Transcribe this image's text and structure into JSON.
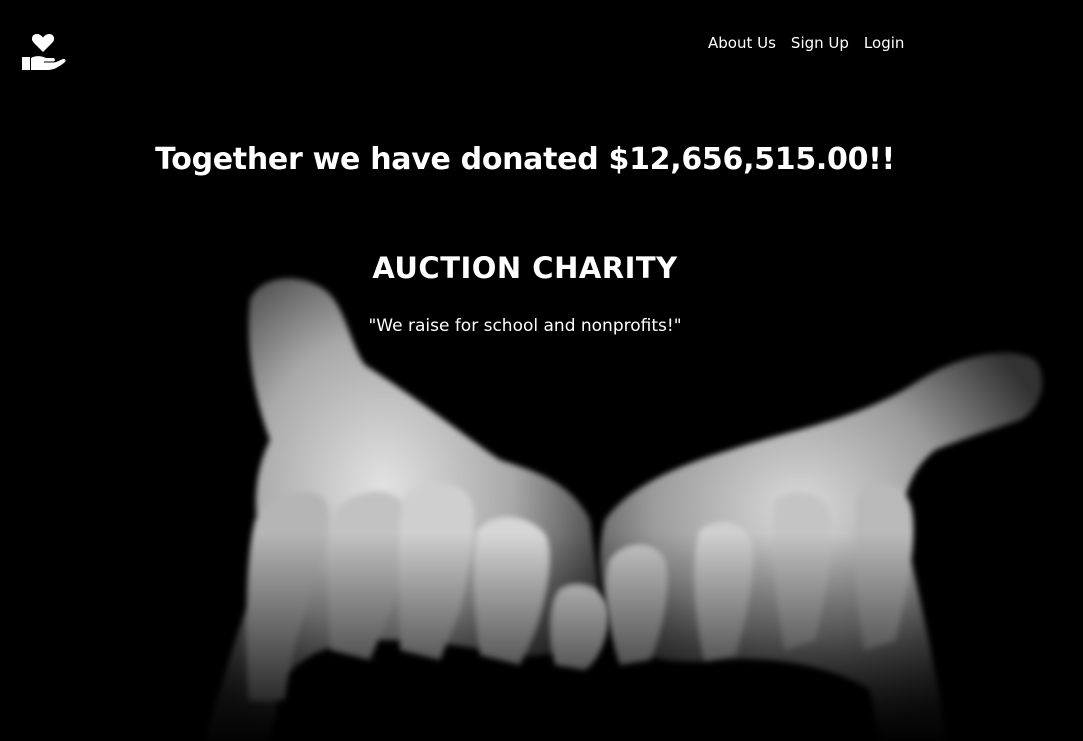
{
  "brand": {
    "logo_icon": "heart-in-hand-icon"
  },
  "nav": {
    "items": [
      {
        "label": "About Us"
      },
      {
        "label": "Sign Up"
      },
      {
        "label": "Login"
      }
    ]
  },
  "hero": {
    "headline": "Together we have donated $12,656,515.00!!",
    "title": "AUCTION CHARITY",
    "tagline": "\"We raise for school and nonprofits!\"",
    "image_icon": "open-hands-photo"
  },
  "colors": {
    "background": "#000000",
    "text": "#ffffff"
  }
}
